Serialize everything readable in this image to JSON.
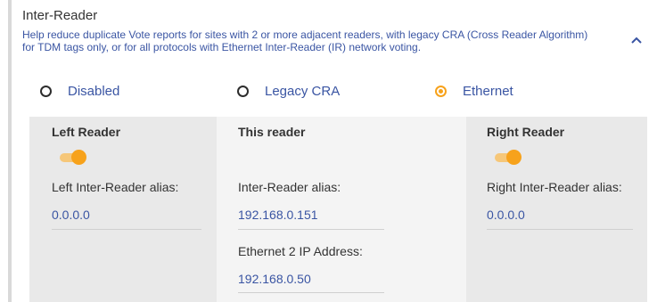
{
  "section": {
    "title": "Inter-Reader",
    "description": "Help reduce duplicate Vote reports for sites with 2 or more adjacent readers, with legacy CRA (Cross Reader Algorithm) for TDM tags only, or for all protocols with Ethernet Inter-Reader (IR) network voting.",
    "collapse_icon": "chevron-up-icon"
  },
  "mode": {
    "options": [
      "Disabled",
      "Legacy CRA",
      "Ethernet"
    ],
    "selected": "Ethernet",
    "accent_color": "#f7a21b"
  },
  "left_reader": {
    "title": "Left Reader",
    "toggle_on": true,
    "alias_label": "Left Inter-Reader alias:",
    "alias_value": "0.0.0.0"
  },
  "this_reader": {
    "title": "This reader",
    "alias_label": "Inter-Reader alias:",
    "alias_value": "192.168.0.151",
    "ip_label": "Ethernet 2 IP Address:",
    "ip_value": "192.168.0.50"
  },
  "right_reader": {
    "title": "Right Reader",
    "toggle_on": true,
    "alias_label": "Right Inter-Reader alias:",
    "alias_value": "0.0.0.0"
  },
  "colors": {
    "link_blue": "#3a55a3",
    "panel_gray": "#e9e9e9",
    "panel_light": "#f4f4f4"
  }
}
